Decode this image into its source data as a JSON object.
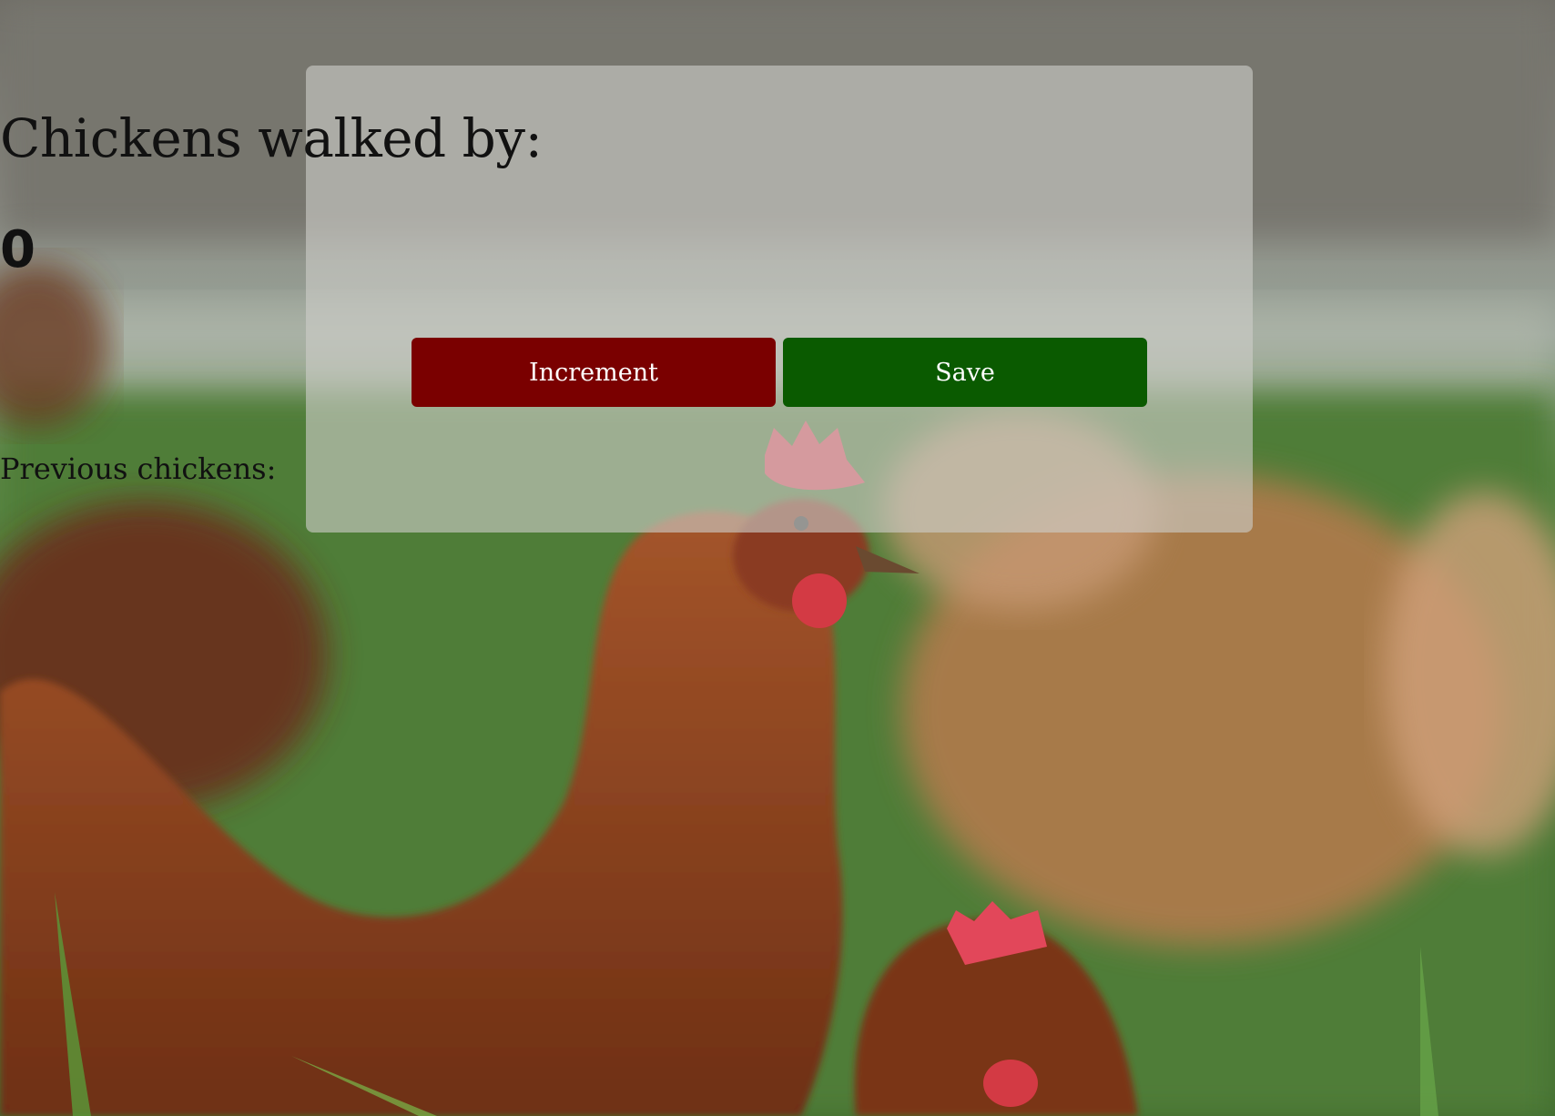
{
  "counter": {
    "title": "Chickens walked by:",
    "count": "0",
    "increment_label": "Increment",
    "save_label": "Save",
    "previous_label": "Previous chickens:"
  },
  "colors": {
    "increment_button": "#7a0000",
    "save_button": "#0a5a00",
    "card_background": "rgba(205,205,200,0.62)"
  },
  "background": {
    "image": "hens-in-grass-photo"
  }
}
